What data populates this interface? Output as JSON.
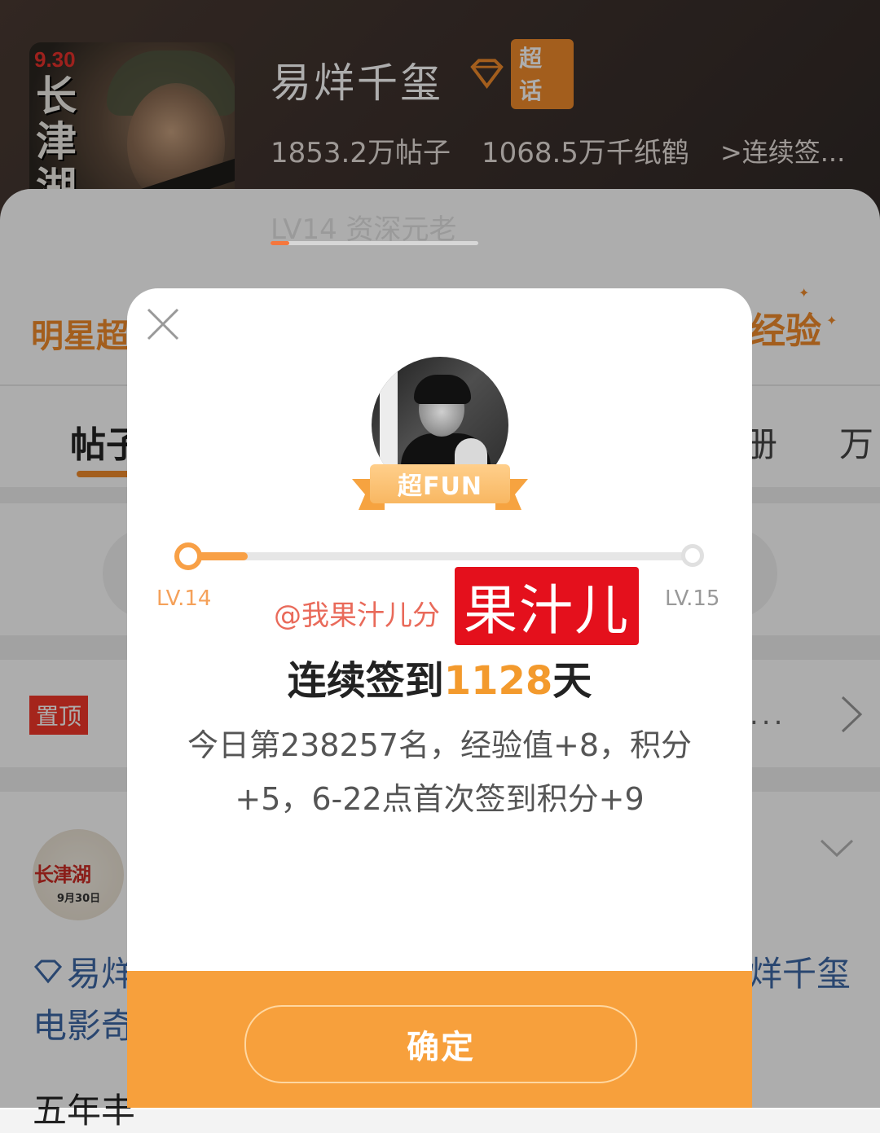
{
  "header": {
    "poster": {
      "date": "9.30",
      "title": "长津湖"
    },
    "title": "易烊千玺",
    "badge_label": "超话",
    "posts_count": "1853.2万帖子",
    "cranes_count": "1068.5万千纸鹤",
    "signin_link": ">连续签...",
    "level_text": "LV14 资深元老",
    "level_progress": 0.09
  },
  "background": {
    "rank_title": "明星超",
    "exp_label": "经验",
    "tabs": {
      "posts": "帖子",
      "right1": "册",
      "right2": "万"
    },
    "pinned": {
      "tag": "置顶",
      "more": "..."
    },
    "feed": {
      "avatar_title": "长津湖",
      "avatar_date": "9月30日",
      "line1_left": "易烊",
      "line1_right": "烊千玺",
      "line2": "电影奇",
      "line3": "五年丰"
    }
  },
  "modal": {
    "badge": "超FUN",
    "progress": 0.12,
    "level_from": "LV.14",
    "level_to": "LV.15",
    "mention": "@我果汁儿分",
    "watermark": "果汁儿",
    "streak_prefix": "连续签到",
    "streak_days": "1128",
    "streak_suffix": "天",
    "reward_line1": "今日第238257名，经验值+8，积分",
    "reward_line2": "+5，6-22点首次签到积分+9",
    "confirm_label": "确定"
  },
  "colors": {
    "accent": "#f7a03c",
    "brand_orange": "#f08b2c",
    "link_blue": "#3d68a5"
  }
}
